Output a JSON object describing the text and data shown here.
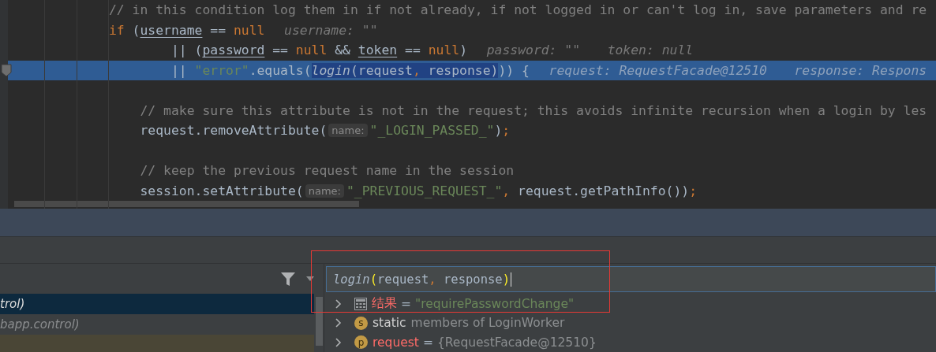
{
  "editor": {
    "lines": [
      {
        "kind": "top",
        "selected": false,
        "segments": [
          {
            "kind": "code",
            "tokens": [
              {
                "kind": "comment",
                "text": "// in this condition log them in if not already, if not logged in or can't log in, save parameters and re"
              }
            ]
          }
        ]
      },
      {
        "kind": "top",
        "selected": false,
        "segments": [
          {
            "kind": "code",
            "tokens": [
              {
                "kind": "keyword",
                "text": "if"
              },
              {
                "kind": "plain",
                "text": " ("
              },
              {
                "kind": "variable",
                "text": "username"
              },
              {
                "kind": "plain",
                "text": " == "
              },
              {
                "kind": "keyword",
                "text": "null"
              }
            ]
          },
          {
            "kind": "hint",
            "text": "username: \"\""
          }
        ]
      },
      {
        "kind": "continuation",
        "selected": false,
        "segments": [
          {
            "kind": "code",
            "tokens": [
              {
                "kind": "plain",
                "text": "|| ("
              },
              {
                "kind": "variable",
                "text": "password"
              },
              {
                "kind": "plain",
                "text": " == "
              },
              {
                "kind": "keyword",
                "text": "null"
              },
              {
                "kind": "plain",
                "text": " && "
              },
              {
                "kind": "variable",
                "text": "token"
              },
              {
                "kind": "plain",
                "text": " == "
              },
              {
                "kind": "keyword",
                "text": "null"
              },
              {
                "kind": "plain",
                "text": ")"
              }
            ]
          },
          {
            "kind": "hint",
            "text": "password: \"\""
          },
          {
            "kind": "hint",
            "text": "token: null"
          }
        ]
      },
      {
        "kind": "continuation",
        "selected": true,
        "segments": [
          {
            "kind": "code",
            "tokens": [
              {
                "kind": "plain",
                "text": "|| "
              },
              {
                "kind": "string",
                "text": "\"error\""
              },
              {
                "kind": "plain",
                "text": ".equals("
              }
            ]
          },
          {
            "kind": "selection",
            "tokens": [
              {
                "kind": "call",
                "text": "login"
              },
              {
                "kind": "plain",
                "text": "(request"
              },
              {
                "kind": "punct",
                "text": ","
              },
              {
                "kind": "plain",
                "text": " response)"
              }
            ]
          },
          {
            "kind": "code",
            "tokens": [
              {
                "kind": "plain",
                "text": ")) {"
              }
            ]
          },
          {
            "kind": "hint",
            "text": "request: RequestFacade@12510"
          },
          {
            "kind": "hint",
            "text": "response: Respons"
          }
        ]
      },
      {
        "kind": "blank",
        "selected": false
      },
      {
        "kind": "body",
        "selected": false,
        "segments": [
          {
            "kind": "code",
            "tokens": [
              {
                "kind": "comment",
                "text": "// make sure this attribute is not in the request; this avoids infinite recursion when a login by les"
              }
            ]
          }
        ]
      },
      {
        "kind": "body",
        "selected": false,
        "segments": [
          {
            "kind": "code",
            "tokens": [
              {
                "kind": "plain",
                "text": "request.removeAttribute("
              }
            ]
          },
          {
            "kind": "param_hint",
            "text": "name:"
          },
          {
            "kind": "code",
            "tokens": [
              {
                "kind": "string",
                "text": "\"_LOGIN_PASSED_\""
              },
              {
                "kind": "plain",
                "text": ")"
              },
              {
                "kind": "punct",
                "text": ";"
              }
            ]
          }
        ]
      },
      {
        "kind": "blank",
        "selected": false
      },
      {
        "kind": "body",
        "selected": false,
        "segments": [
          {
            "kind": "code",
            "tokens": [
              {
                "kind": "comment",
                "text": "// keep the previous request name in the session"
              }
            ]
          }
        ]
      },
      {
        "kind": "body",
        "selected": false,
        "segments": [
          {
            "kind": "code",
            "tokens": [
              {
                "kind": "plain",
                "text": "session.setAttribute("
              }
            ]
          },
          {
            "kind": "param_hint",
            "text": "name:"
          },
          {
            "kind": "code",
            "tokens": [
              {
                "kind": "string",
                "text": "\"_PREVIOUS_REQUEST_\""
              },
              {
                "kind": "punct",
                "text": ","
              },
              {
                "kind": "plain",
                "text": " request.getPathInfo())"
              },
              {
                "kind": "punct",
                "text": ";"
              }
            ]
          }
        ]
      }
    ]
  },
  "debugger": {
    "frames": [
      {
        "text": "trol)",
        "selected": true
      },
      {
        "text": "bapp.control)",
        "selected": false
      }
    ],
    "expression": {
      "tokens": [
        {
          "kind": "call",
          "text": "login"
        },
        {
          "kind": "bracket",
          "text": "("
        },
        {
          "kind": "plain",
          "text": "request"
        },
        {
          "kind": "punct",
          "text": ","
        },
        {
          "kind": "plain",
          "text": " response"
        },
        {
          "kind": "bracket",
          "text": ")"
        }
      ]
    },
    "variables": [
      {
        "kind": "result",
        "expanded": false,
        "name": "结果",
        "separator": "=",
        "value": "\"requirePasswordChange\""
      },
      {
        "kind": "static",
        "expanded": false,
        "badge": "s",
        "name": "static",
        "value": "members of LoginWorker"
      },
      {
        "kind": "parameter",
        "expanded": false,
        "badge": "p",
        "name": "request",
        "separator": "=",
        "value": "{RequestFacade@12510}"
      }
    ]
  }
}
